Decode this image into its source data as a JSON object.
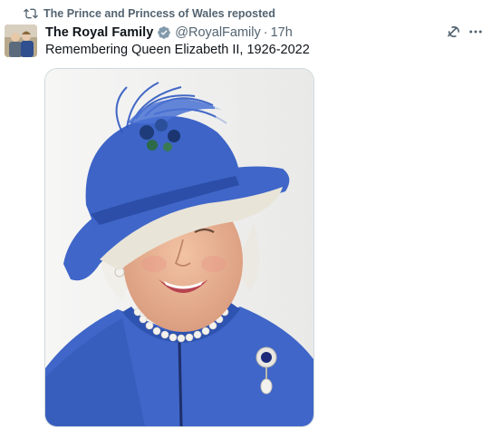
{
  "repost": {
    "text": "The Prince and Princess of Wales reposted"
  },
  "tweet": {
    "display_name": "The Royal Family",
    "handle": "@RoyalFamily",
    "separator": "·",
    "time": "17h",
    "text": "Remembering Queen Elizabeth II, 1926-2022"
  },
  "icons": {
    "repost": "repost-icon",
    "verified": "verified-badge-icon",
    "grok": "grok-icon",
    "more": "more-options-icon"
  },
  "colors": {
    "secondary_text": "#536471",
    "verified_gray": "#829aab",
    "hat_blue": "#3a63c4"
  }
}
